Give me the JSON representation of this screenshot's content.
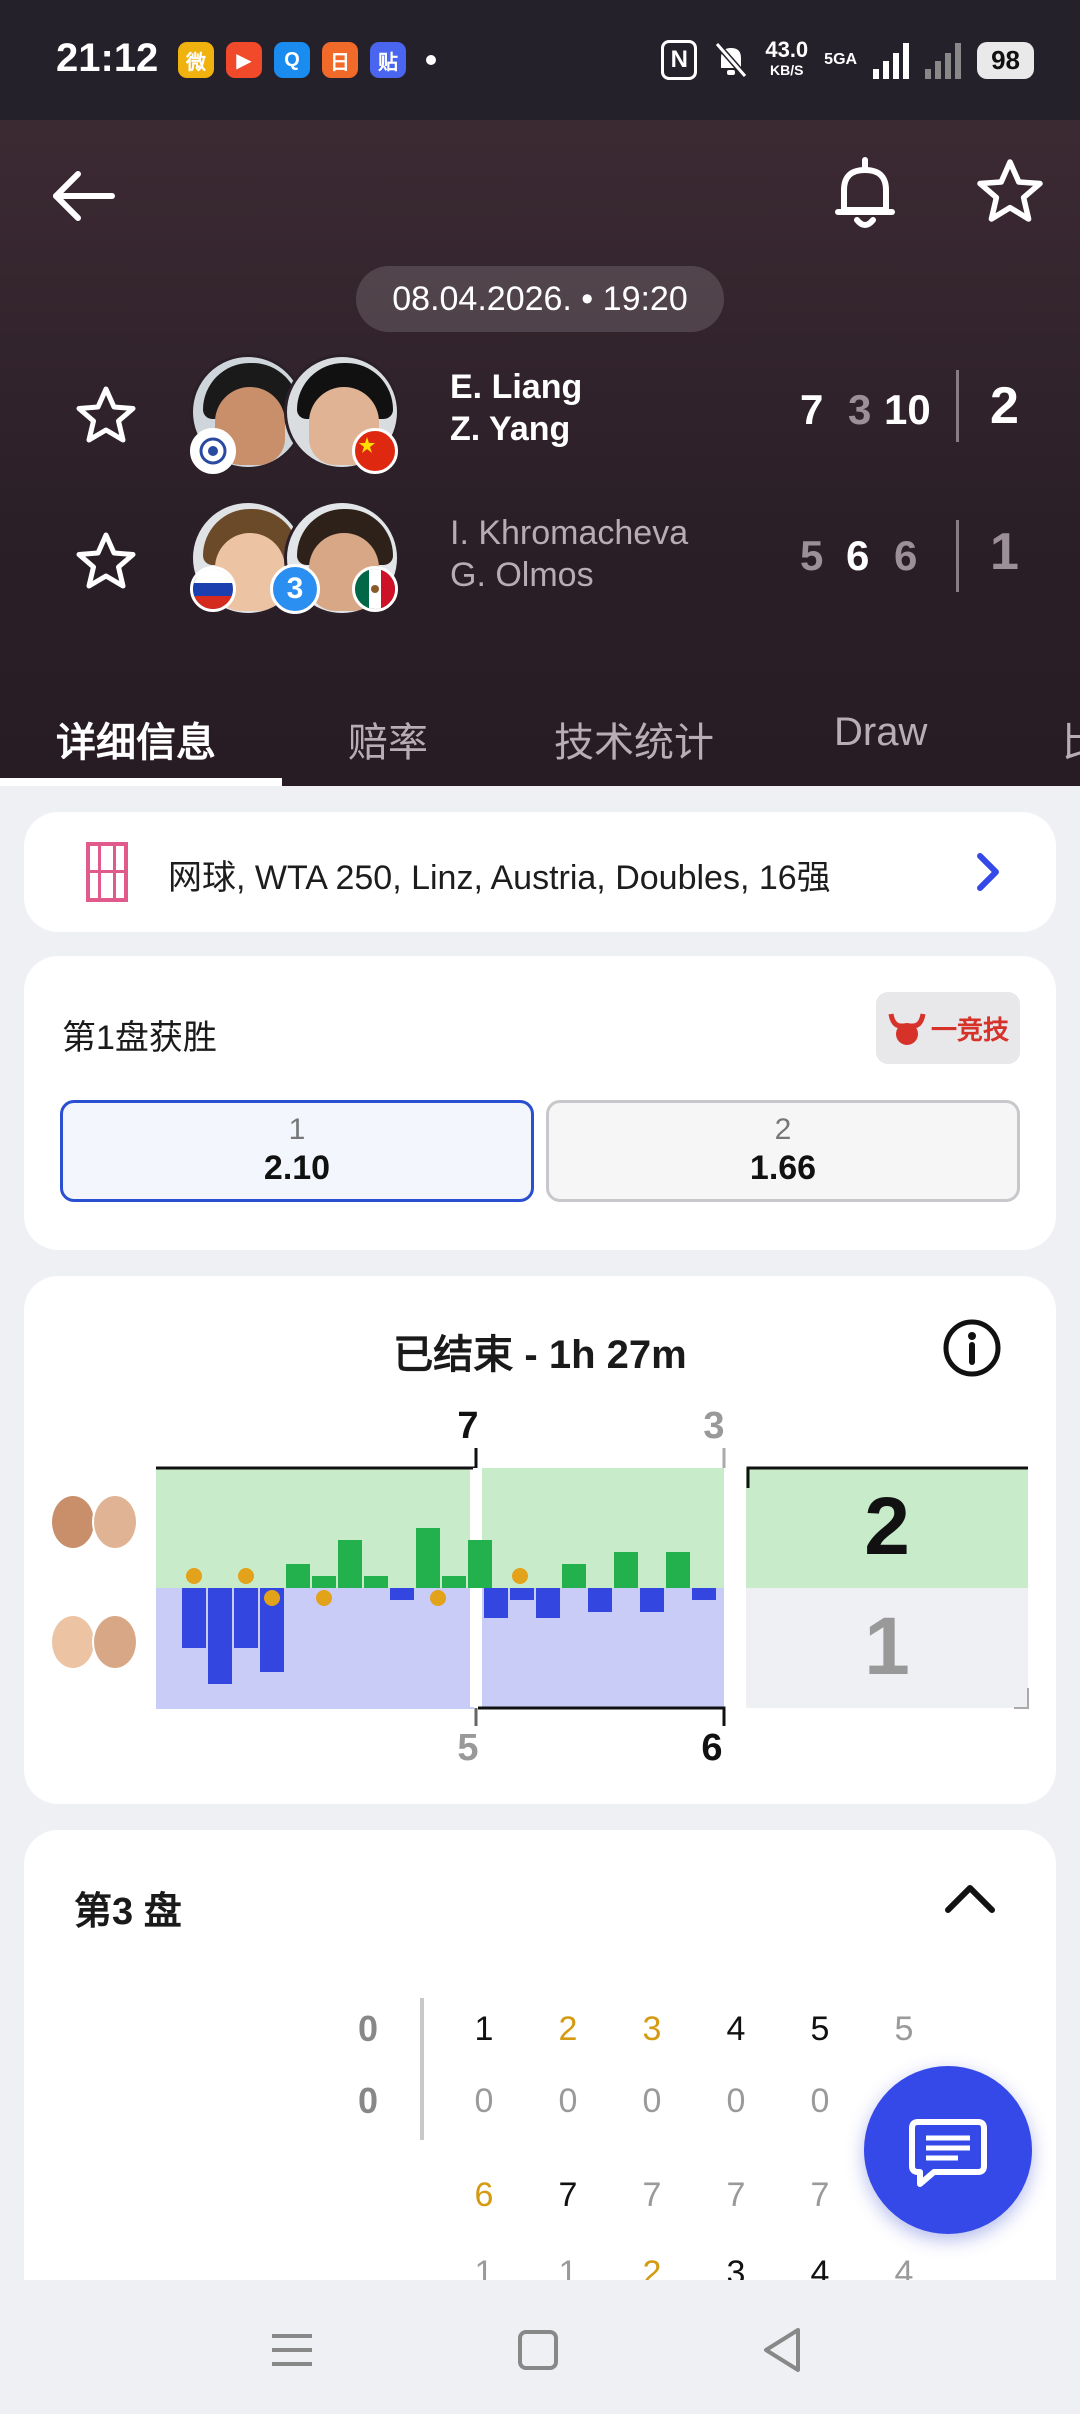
{
  "status_bar": {
    "time": "21:12",
    "speed": "43.0",
    "speed_unit": "KB/S",
    "network": "5GA",
    "battery": "98",
    "apps": [
      "weibo-icon",
      "video-app-icon",
      "qq-browser-icon",
      "calendar-app-icon",
      "tieba-icon"
    ],
    "nfc_label": "N"
  },
  "match": {
    "datetime": "08.04.2026. • 19:20",
    "team1": {
      "player1": "E. Liang",
      "player2": "Z. Yang",
      "sets": [
        "7",
        "3",
        "10"
      ],
      "total": "2"
    },
    "team2": {
      "player1": "I. Khromacheva",
      "player2": "G. Olmos",
      "sets": [
        "5",
        "6",
        "6"
      ],
      "total": "1",
      "seed": "3"
    }
  },
  "tabs": [
    "详细信息",
    "赔率",
    "技术统计",
    "Draw",
    "比"
  ],
  "competition": "网球, WTA 250, Linz, Austria, Doubles, 16强",
  "odds": {
    "title": "第1盘获胜",
    "bookmaker": "一竞技",
    "options": [
      {
        "label": "1",
        "value": "2.10"
      },
      {
        "label": "2",
        "value": "1.66"
      }
    ]
  },
  "momentum": {
    "title": "已结束 - 1h 27m",
    "set_scores_top": [
      "7",
      "3"
    ],
    "set_scores_bottom": [
      "5",
      "6"
    ],
    "final_top": "2",
    "final_bottom": "1",
    "bars_set1": [
      0,
      0,
      -1,
      -1.6,
      -1,
      -1.4,
      0.4,
      0.2,
      0.8,
      0.2,
      -0.2,
      1.0,
      0.2,
      0.8
    ],
    "bars_set2": [
      -0.5,
      -0.2,
      -0.5,
      0.4,
      -0.4,
      0.6,
      -0.4,
      0.6,
      -0.2
    ],
    "colors": {
      "team1": "#22b14c",
      "team2": "#3346e0"
    }
  },
  "set_detail": {
    "title": "第3 盘",
    "game_score_top": "0",
    "game_score_bottom": "0",
    "row1_top": [
      "1",
      "2",
      "3",
      "4",
      "5",
      "5"
    ],
    "row1_bottom": [
      "0",
      "0",
      "0",
      "0",
      "0"
    ],
    "row2_top": [
      "6",
      "7",
      "7",
      "7",
      "7"
    ],
    "row2_bottom": [
      "1",
      "1",
      "2",
      "3",
      "4",
      "4"
    ]
  }
}
